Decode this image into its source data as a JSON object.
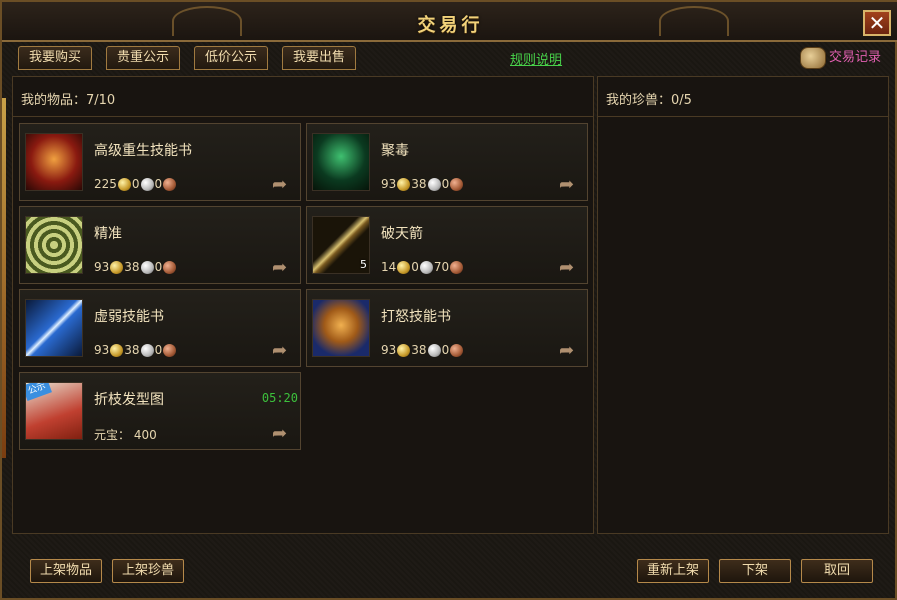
{
  "window": {
    "title": "交易行",
    "close_label": "✕"
  },
  "tabs": [
    {
      "label": "我要购买"
    },
    {
      "label": "贵重公示"
    },
    {
      "label": "低价公示"
    },
    {
      "label": "我要出售"
    }
  ],
  "rules_label": "规则说明",
  "record_label": "交易记录",
  "my_items": {
    "label": "我的物品：7/10",
    "items": [
      {
        "name": "高级重生技能书",
        "price": [
          "225",
          "0",
          "0"
        ],
        "icon": "red-beast-icon"
      },
      {
        "name": "聚毒",
        "price": [
          "93",
          "38",
          "0"
        ],
        "icon": "green-warrior-icon"
      },
      {
        "name": "精准",
        "price": [
          "93",
          "38",
          "0"
        ],
        "icon": "target-icon"
      },
      {
        "name": "破天箭",
        "price": [
          "14",
          "0",
          "70"
        ],
        "icon": "arrow-icon",
        "quantity": "5"
      },
      {
        "name": "虚弱技能书",
        "price": [
          "93",
          "38",
          "0"
        ],
        "icon": "blue-blade-icon"
      },
      {
        "name": "打怒技能书",
        "price": [
          "93",
          "38",
          "0"
        ],
        "icon": "tiger-icon"
      },
      {
        "name": "折枝发型图",
        "price_text": "元宝： 400",
        "icon": "scroll-map-icon",
        "timer": "05:20",
        "badge": "公示"
      }
    ]
  },
  "my_pets": {
    "label": "我的珍兽：0/5"
  },
  "buttons": {
    "list_item": "上架物品",
    "list_pet": "上架珍兽",
    "relist": "重新上架",
    "delist": "下架",
    "retrieve": "取回"
  },
  "colors": {
    "accent_gold": "#f2d27a",
    "link_green": "#48d24a",
    "record_pink": "#e05fb0",
    "timer_green": "#3cc03c"
  }
}
